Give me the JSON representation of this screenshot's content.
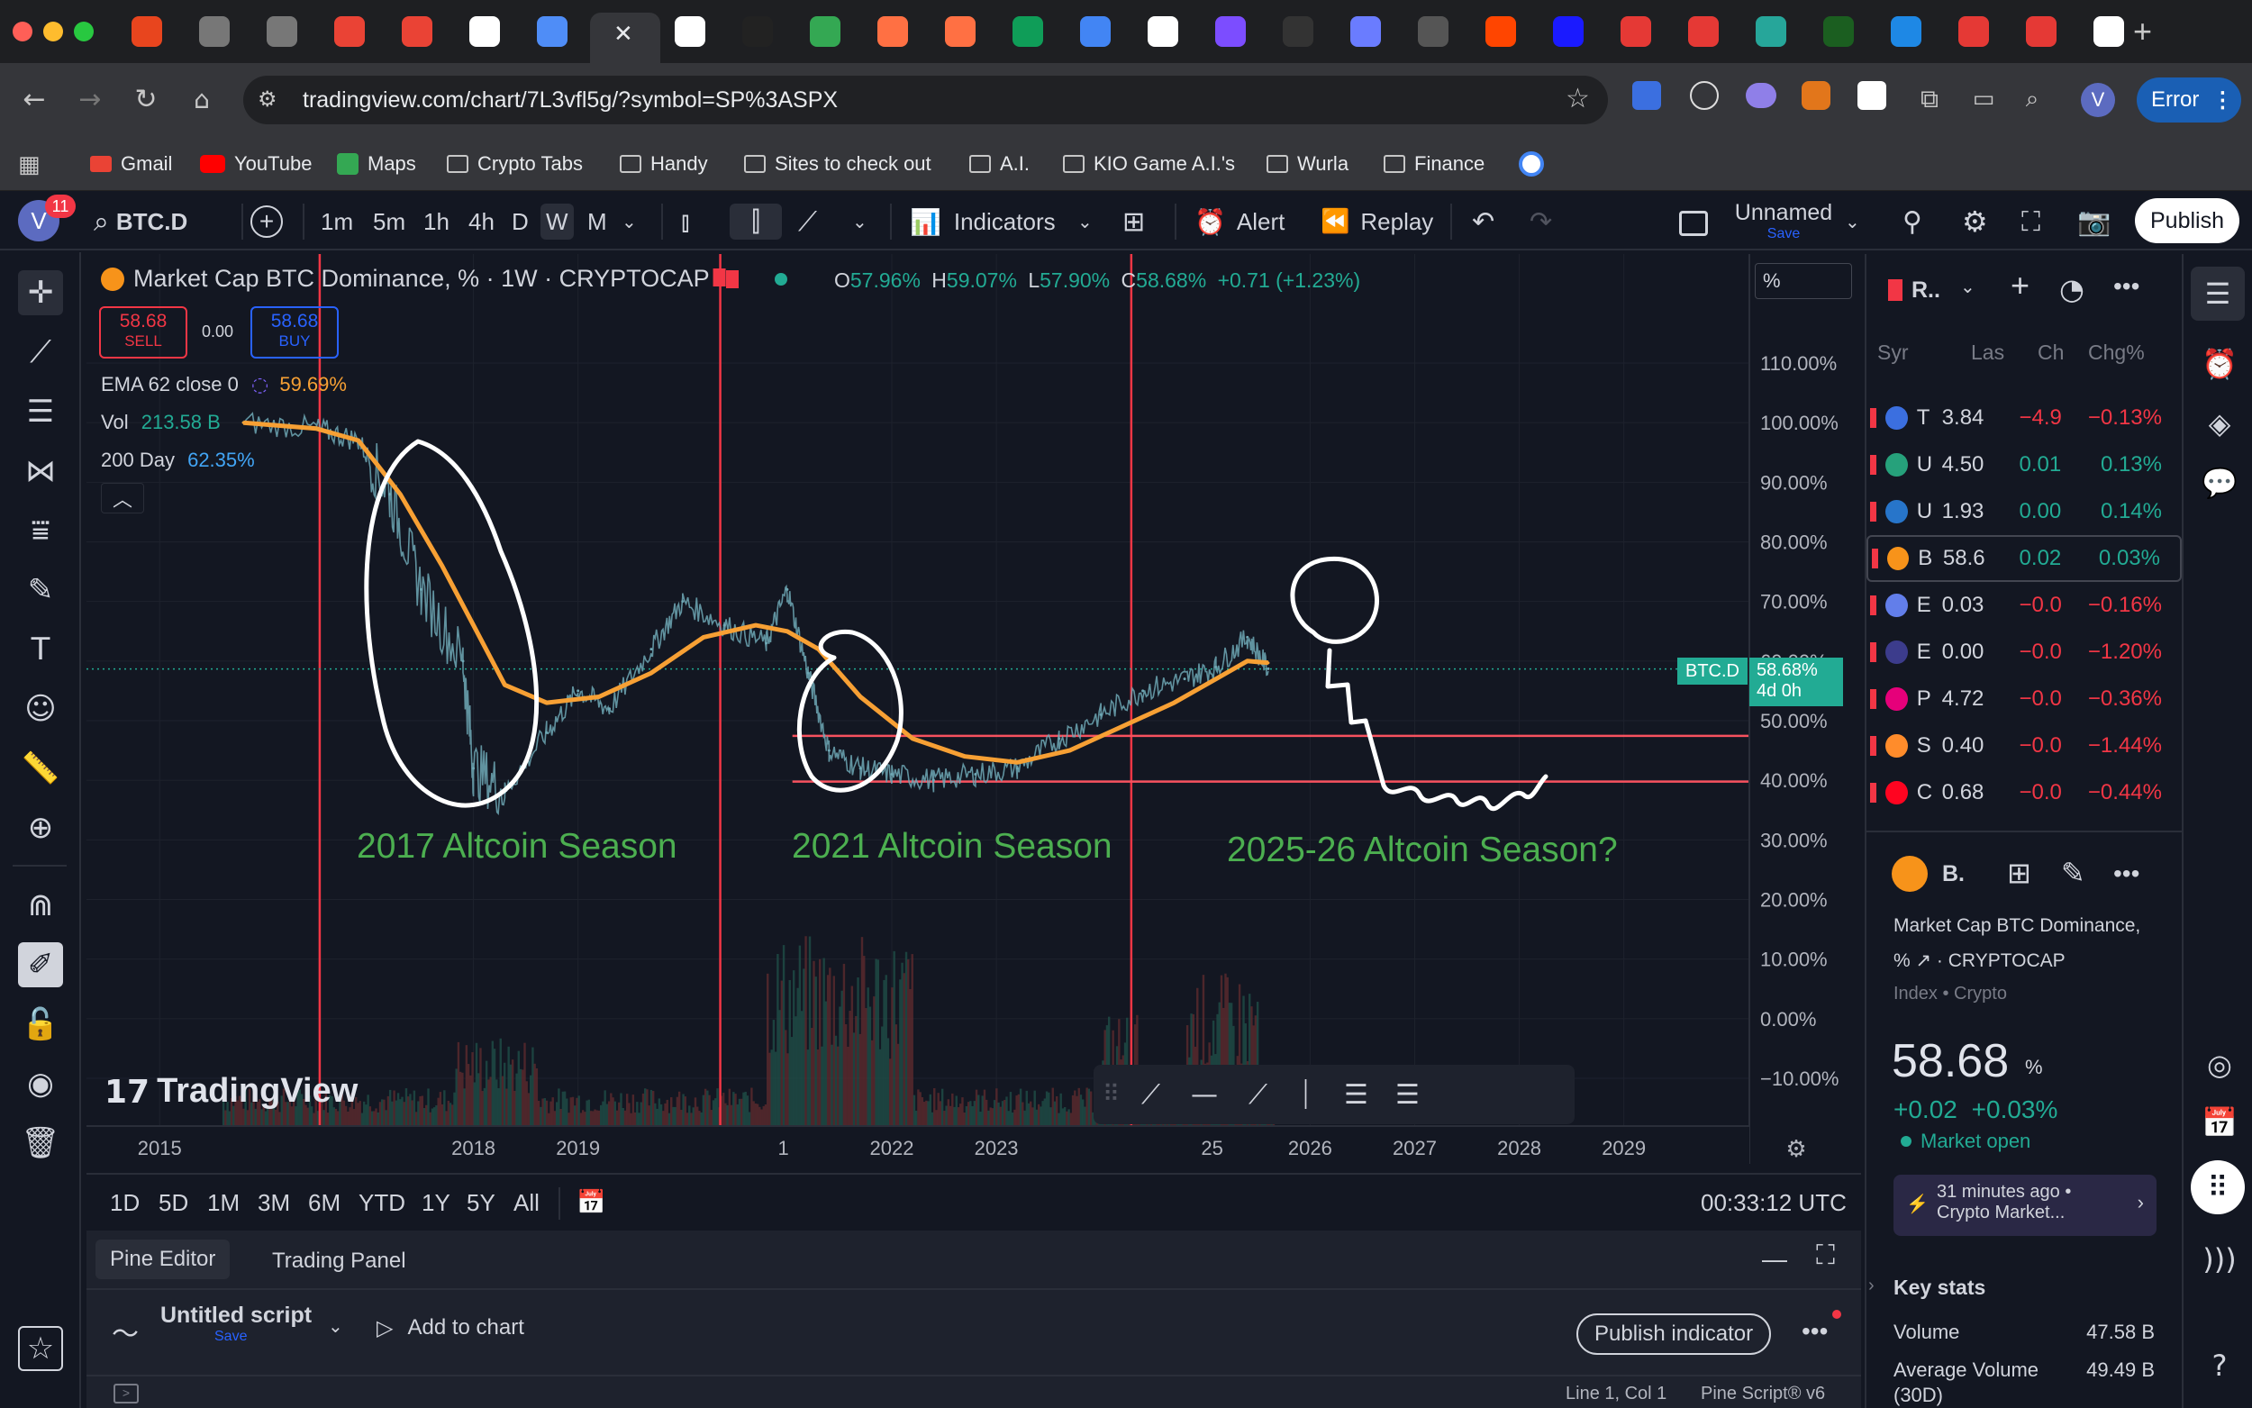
{
  "browser": {
    "url": "tradingview.com/chart/7L3vfl5g/?symbol=SP%3ASPX",
    "profile_initial": "V",
    "error_label": "Error",
    "bookmarks": [
      "Gmail",
      "YouTube",
      "Maps",
      "Crypto Tabs",
      "Handy",
      "Sites to check out",
      "A.I.",
      "KIO Game A.I.'s",
      "Wurla",
      "Finance"
    ]
  },
  "toolbar": {
    "avatar_initial": "V",
    "notif_count": "11",
    "symbol": "BTC.D",
    "intervals": [
      "1m",
      "5m",
      "1h",
      "4h",
      "D",
      "W",
      "M"
    ],
    "active_interval": "W",
    "indicators_label": "Indicators",
    "alert_label": "Alert",
    "replay_label": "Replay",
    "layout_name": "Unnamed",
    "save_label": "Save",
    "publish_label": "Publish"
  },
  "legend": {
    "title": "Market Cap BTC Dominance, % · 1W · CRYPTOCAP",
    "o_label": "O",
    "o_val": "57.96%",
    "h_label": "H",
    "h_val": "59.07%",
    "l_label": "L",
    "l_val": "57.90%",
    "c_label": "C",
    "c_val": "58.68%",
    "change": "+0.71 (+1.23%)",
    "sell_price": "58.68",
    "sell_label": "SELL",
    "spread": "0.00",
    "buy_price": "58.68",
    "buy_label": "BUY",
    "ema_label": "EMA 62 close 0",
    "ema_val": "59.69%",
    "vol_label": "Vol",
    "vol_val": "213.58 B",
    "ma_label": "200 Day",
    "ma_val": "62.35%"
  },
  "chart_data": {
    "type": "line",
    "title": "Market Cap BTC Dominance, % · 1W · CRYPTOCAP",
    "ylabel": "%",
    "ylim": [
      -10,
      120
    ],
    "y_ticks": [
      "110.00%",
      "100.00%",
      "90.00%",
      "80.00%",
      "70.00%",
      "60.00%",
      "50.00%",
      "40.00%",
      "30.00%",
      "20.00%",
      "10.00%",
      "0.00%",
      "−10.00%"
    ],
    "x_ticks": [
      "2015",
      "2018",
      "2019",
      "2022",
      "2023",
      "2026",
      "2027",
      "2028",
      "2029"
    ],
    "x_partial_ticks": [
      "1",
      "25"
    ],
    "series": [
      {
        "name": "BTC.D",
        "x": [
          2015.8,
          2016.5,
          2016.9,
          2017.2,
          2017.5,
          2017.9,
          2018.0,
          2018.3,
          2018.7,
          2019.0,
          2019.3,
          2019.7,
          2020.0,
          2020.4,
          2020.8,
          2021.0,
          2021.2,
          2021.4,
          2021.7,
          2022.0,
          2022.4,
          2022.8,
          2023.2,
          2023.6,
          2024.0,
          2024.4,
          2024.8,
          2025.1,
          2025.4,
          2025.6
        ],
        "values": [
          100,
          99,
          97,
          88,
          72,
          60,
          42,
          38,
          48,
          55,
          52,
          62,
          70,
          66,
          63,
          72,
          58,
          45,
          42,
          41,
          40,
          41,
          42,
          47,
          51,
          55,
          57,
          59,
          64,
          58.7
        ]
      },
      {
        "name": "EMA 62",
        "x": [
          2015.8,
          2016.5,
          2016.9,
          2017.3,
          2017.7,
          2018.0,
          2018.3,
          2018.7,
          2019.2,
          2019.7,
          2020.2,
          2020.7,
          2021.0,
          2021.3,
          2021.7,
          2022.2,
          2022.7,
          2023.2,
          2023.7,
          2024.2,
          2024.7,
          2025.1,
          2025.4,
          2025.6
        ],
        "values": [
          100,
          99,
          97,
          88,
          76,
          66,
          56,
          53,
          54,
          58,
          64,
          66,
          65,
          62,
          54,
          47,
          44,
          43,
          45,
          49,
          53,
          57,
          60,
          59.7
        ]
      }
    ],
    "horizontal_lines": [
      47.45,
      39.78
    ],
    "vertical_markers": [
      "Mon 11 Jul '16",
      "Mon 11 May '20",
      "Mon 15 Apr '24"
    ],
    "price_label": "58.68%",
    "price_countdown": "4d 0h",
    "price_symbol": "BTC.D",
    "annotations": [
      "2017 Altcoin Season",
      "2021 Altcoin Season",
      "2025-26 Altcoin Season?"
    ]
  },
  "chart_misc": {
    "scale_unit": "%",
    "logo": "TradingView",
    "clock": "00:33:12 UTC",
    "ranges": [
      "1D",
      "5D",
      "1M",
      "3M",
      "6M",
      "YTD",
      "1Y",
      "5Y",
      "All"
    ]
  },
  "watchlist": {
    "title": "R..",
    "cols": [
      "Syr",
      "Las",
      "Ch",
      "Chg%"
    ],
    "rows": [
      {
        "sym": "T",
        "last": "3.84",
        "ch": "−4.9",
        "chg": "−0.13%",
        "dir": "red",
        "icon": "#3b6fe0"
      },
      {
        "sym": "U",
        "last": "4.50",
        "ch": "0.01",
        "chg": "0.13%",
        "dir": "grn",
        "icon": "#26a17b"
      },
      {
        "sym": "U",
        "last": "1.93",
        "ch": "0.00",
        "chg": "0.14%",
        "dir": "grn",
        "icon": "#2775ca"
      },
      {
        "sym": "B",
        "last": "58.6",
        "ch": "0.02",
        "chg": "0.03%",
        "dir": "grn",
        "icon": "#f7931a"
      },
      {
        "sym": "E",
        "last": "0.03",
        "ch": "−0.0",
        "chg": "−0.16%",
        "dir": "red",
        "icon": "#627eea"
      },
      {
        "sym": "E",
        "last": "0.00",
        "ch": "−0.0",
        "chg": "−1.20%",
        "dir": "red",
        "icon": "#3c3c8c"
      },
      {
        "sym": "P",
        "last": "4.72",
        "ch": "−0.0",
        "chg": "−0.36%",
        "dir": "red",
        "icon": "#e6007a"
      },
      {
        "sym": "S",
        "last": "0.40",
        "ch": "−0.0",
        "chg": "−1.44%",
        "dir": "red",
        "icon": "#ff8c2b"
      },
      {
        "sym": "C",
        "last": "0.68",
        "ch": "−0.0",
        "chg": "−0.44%",
        "dir": "red",
        "icon": "#ff0420"
      }
    ]
  },
  "details": {
    "short": "B.",
    "name_line1": "Market Cap BTC Dominance,",
    "name_line2": "% ↗ · CRYPTOCAP",
    "category": "Index • Crypto",
    "price": "58.68",
    "unit": "%",
    "change": "+0.02",
    "change_pct": "+0.03%",
    "market_status": "Market open",
    "news_time": "31 minutes ago •",
    "news_title": "Crypto Market...",
    "key_stats": "Key stats",
    "volume_label": "Volume",
    "volume_val": "47.58 B",
    "avgvol_label": "Average Volume",
    "avgvol_sub": "(30D)",
    "avgvol_val": "49.49 B"
  },
  "bottom": {
    "tab_pine": "Pine Editor",
    "tab_trading": "Trading Panel",
    "script_name": "Untitled script",
    "script_save": "Save",
    "add_to_chart": "Add to chart",
    "publish_indicator": "Publish indicator",
    "cursor_pos": "Line 1, Col 1",
    "pine_version": "Pine Script® v6"
  }
}
